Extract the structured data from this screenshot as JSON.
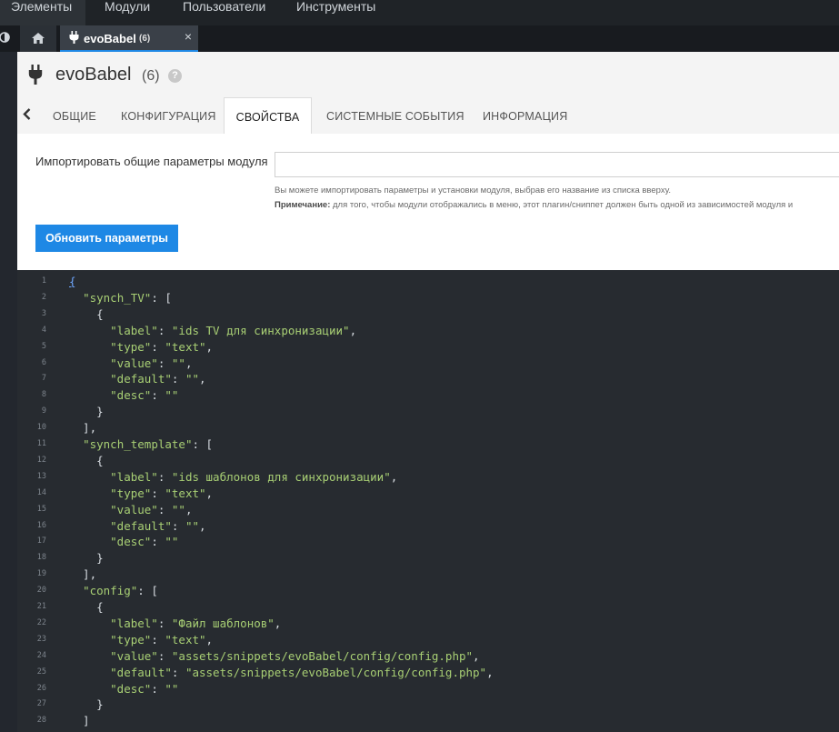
{
  "top_menu": [
    "Элементы",
    "Модули",
    "Пользователи",
    "Инструменты"
  ],
  "tabbar": {
    "doc_title": "evoBabel",
    "doc_count": "(6)",
    "close": "×"
  },
  "page": {
    "title": "evoBabel",
    "count": "(6)",
    "help": "?"
  },
  "tabs": [
    "ОБЩИЕ",
    "КОНФИГУРАЦИЯ",
    "СВОЙСТВА",
    "СИСТЕМНЫЕ СОБЫТИЯ",
    "ИНФОРМАЦИЯ"
  ],
  "active_tab": "СВОЙСТВА",
  "form": {
    "import_label": "Импортировать общие параметры модуля",
    "import_value": "",
    "hint": "Вы можете импортировать параметры и установки модуля, выбрав его название из списка вверху.",
    "note_label": "Примечание:",
    "note_text": " для того, чтобы модули отображались в меню, этот плагин/сниппет должен быть одной из зависимостей модуля и",
    "update_button": "Обновить параметры"
  },
  "editor": {
    "line_numbers": [
      "1",
      "2",
      "3",
      "4",
      "5",
      "6",
      "7",
      "8",
      "9",
      "10",
      "11",
      "12",
      "13",
      "14",
      "15",
      "16",
      "17",
      "18",
      "19",
      "20",
      "21",
      "22",
      "23",
      "24",
      "25",
      "26",
      "27",
      "28"
    ],
    "lines": [
      "{",
      "  \"synch_TV\": [",
      "    {",
      "      \"label\": \"ids TV для синхронизации\",",
      "      \"type\": \"text\",",
      "      \"value\": \"\",",
      "      \"default\": \"\",",
      "      \"desc\": \"\"",
      "    }",
      "  ],",
      "  \"synch_template\": [",
      "    {",
      "      \"label\": \"ids шаблонов для синхронизации\",",
      "      \"type\": \"text\",",
      "      \"value\": \"\",",
      "      \"default\": \"\",",
      "      \"desc\": \"\"",
      "    }",
      "  ],",
      "  \"config\": [",
      "    {",
      "      \"label\": \"Файл шаблонов\",",
      "      \"type\": \"text\",",
      "      \"value\": \"assets/snippets/evoBabel/config/config.php\",",
      "      \"default\": \"assets/snippets/evoBabel/config/config.php\",",
      "      \"desc\": \"\"",
      "    }",
      "  ]"
    ]
  },
  "colors": {
    "accent": "#1e88e5",
    "editor_bg": "#272b30",
    "string_green": "#a8cf74"
  }
}
